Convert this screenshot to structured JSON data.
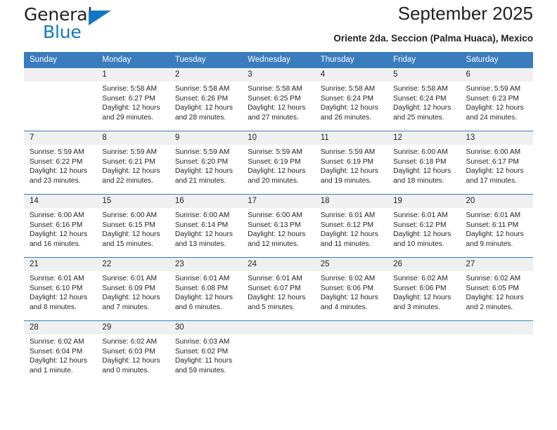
{
  "brand": {
    "name_part1": "General",
    "name_part2": "Blue",
    "accent_color": "#1277c4"
  },
  "header": {
    "title": "September 2025",
    "subtitle": "Oriente 2da. Seccion (Palma Huaca), Mexico",
    "header_bg_color": "#3a7cbe",
    "daynum_bg_color": "#f0f0f0"
  },
  "weekdays": [
    "Sunday",
    "Monday",
    "Tuesday",
    "Wednesday",
    "Thursday",
    "Friday",
    "Saturday"
  ],
  "weeks": [
    [
      {
        "day": "",
        "sunrise": "",
        "sunset": "",
        "daylight1": "",
        "daylight2": ""
      },
      {
        "day": "1",
        "sunrise": "Sunrise: 5:58 AM",
        "sunset": "Sunset: 6:27 PM",
        "daylight1": "Daylight: 12 hours",
        "daylight2": "and 29 minutes."
      },
      {
        "day": "2",
        "sunrise": "Sunrise: 5:58 AM",
        "sunset": "Sunset: 6:26 PM",
        "daylight1": "Daylight: 12 hours",
        "daylight2": "and 28 minutes."
      },
      {
        "day": "3",
        "sunrise": "Sunrise: 5:58 AM",
        "sunset": "Sunset: 6:25 PM",
        "daylight1": "Daylight: 12 hours",
        "daylight2": "and 27 minutes."
      },
      {
        "day": "4",
        "sunrise": "Sunrise: 5:58 AM",
        "sunset": "Sunset: 6:24 PM",
        "daylight1": "Daylight: 12 hours",
        "daylight2": "and 26 minutes."
      },
      {
        "day": "5",
        "sunrise": "Sunrise: 5:58 AM",
        "sunset": "Sunset: 6:24 PM",
        "daylight1": "Daylight: 12 hours",
        "daylight2": "and 25 minutes."
      },
      {
        "day": "6",
        "sunrise": "Sunrise: 5:59 AM",
        "sunset": "Sunset: 6:23 PM",
        "daylight1": "Daylight: 12 hours",
        "daylight2": "and 24 minutes."
      }
    ],
    [
      {
        "day": "7",
        "sunrise": "Sunrise: 5:59 AM",
        "sunset": "Sunset: 6:22 PM",
        "daylight1": "Daylight: 12 hours",
        "daylight2": "and 23 minutes."
      },
      {
        "day": "8",
        "sunrise": "Sunrise: 5:59 AM",
        "sunset": "Sunset: 6:21 PM",
        "daylight1": "Daylight: 12 hours",
        "daylight2": "and 22 minutes."
      },
      {
        "day": "9",
        "sunrise": "Sunrise: 5:59 AM",
        "sunset": "Sunset: 6:20 PM",
        "daylight1": "Daylight: 12 hours",
        "daylight2": "and 21 minutes."
      },
      {
        "day": "10",
        "sunrise": "Sunrise: 5:59 AM",
        "sunset": "Sunset: 6:19 PM",
        "daylight1": "Daylight: 12 hours",
        "daylight2": "and 20 minutes."
      },
      {
        "day": "11",
        "sunrise": "Sunrise: 5:59 AM",
        "sunset": "Sunset: 6:19 PM",
        "daylight1": "Daylight: 12 hours",
        "daylight2": "and 19 minutes."
      },
      {
        "day": "12",
        "sunrise": "Sunrise: 6:00 AM",
        "sunset": "Sunset: 6:18 PM",
        "daylight1": "Daylight: 12 hours",
        "daylight2": "and 18 minutes."
      },
      {
        "day": "13",
        "sunrise": "Sunrise: 6:00 AM",
        "sunset": "Sunset: 6:17 PM",
        "daylight1": "Daylight: 12 hours",
        "daylight2": "and 17 minutes."
      }
    ],
    [
      {
        "day": "14",
        "sunrise": "Sunrise: 6:00 AM",
        "sunset": "Sunset: 6:16 PM",
        "daylight1": "Daylight: 12 hours",
        "daylight2": "and 16 minutes."
      },
      {
        "day": "15",
        "sunrise": "Sunrise: 6:00 AM",
        "sunset": "Sunset: 6:15 PM",
        "daylight1": "Daylight: 12 hours",
        "daylight2": "and 15 minutes."
      },
      {
        "day": "16",
        "sunrise": "Sunrise: 6:00 AM",
        "sunset": "Sunset: 6:14 PM",
        "daylight1": "Daylight: 12 hours",
        "daylight2": "and 13 minutes."
      },
      {
        "day": "17",
        "sunrise": "Sunrise: 6:00 AM",
        "sunset": "Sunset: 6:13 PM",
        "daylight1": "Daylight: 12 hours",
        "daylight2": "and 12 minutes."
      },
      {
        "day": "18",
        "sunrise": "Sunrise: 6:01 AM",
        "sunset": "Sunset: 6:12 PM",
        "daylight1": "Daylight: 12 hours",
        "daylight2": "and 11 minutes."
      },
      {
        "day": "19",
        "sunrise": "Sunrise: 6:01 AM",
        "sunset": "Sunset: 6:12 PM",
        "daylight1": "Daylight: 12 hours",
        "daylight2": "and 10 minutes."
      },
      {
        "day": "20",
        "sunrise": "Sunrise: 6:01 AM",
        "sunset": "Sunset: 6:11 PM",
        "daylight1": "Daylight: 12 hours",
        "daylight2": "and 9 minutes."
      }
    ],
    [
      {
        "day": "21",
        "sunrise": "Sunrise: 6:01 AM",
        "sunset": "Sunset: 6:10 PM",
        "daylight1": "Daylight: 12 hours",
        "daylight2": "and 8 minutes."
      },
      {
        "day": "22",
        "sunrise": "Sunrise: 6:01 AM",
        "sunset": "Sunset: 6:09 PM",
        "daylight1": "Daylight: 12 hours",
        "daylight2": "and 7 minutes."
      },
      {
        "day": "23",
        "sunrise": "Sunrise: 6:01 AM",
        "sunset": "Sunset: 6:08 PM",
        "daylight1": "Daylight: 12 hours",
        "daylight2": "and 6 minutes."
      },
      {
        "day": "24",
        "sunrise": "Sunrise: 6:01 AM",
        "sunset": "Sunset: 6:07 PM",
        "daylight1": "Daylight: 12 hours",
        "daylight2": "and 5 minutes."
      },
      {
        "day": "25",
        "sunrise": "Sunrise: 6:02 AM",
        "sunset": "Sunset: 6:06 PM",
        "daylight1": "Daylight: 12 hours",
        "daylight2": "and 4 minutes."
      },
      {
        "day": "26",
        "sunrise": "Sunrise: 6:02 AM",
        "sunset": "Sunset: 6:06 PM",
        "daylight1": "Daylight: 12 hours",
        "daylight2": "and 3 minutes."
      },
      {
        "day": "27",
        "sunrise": "Sunrise: 6:02 AM",
        "sunset": "Sunset: 6:05 PM",
        "daylight1": "Daylight: 12 hours",
        "daylight2": "and 2 minutes."
      }
    ],
    [
      {
        "day": "28",
        "sunrise": "Sunrise: 6:02 AM",
        "sunset": "Sunset: 6:04 PM",
        "daylight1": "Daylight: 12 hours",
        "daylight2": "and 1 minute."
      },
      {
        "day": "29",
        "sunrise": "Sunrise: 6:02 AM",
        "sunset": "Sunset: 6:03 PM",
        "daylight1": "Daylight: 12 hours",
        "daylight2": "and 0 minutes."
      },
      {
        "day": "30",
        "sunrise": "Sunrise: 6:03 AM",
        "sunset": "Sunset: 6:02 PM",
        "daylight1": "Daylight: 11 hours",
        "daylight2": "and 59 minutes."
      },
      {
        "day": "",
        "sunrise": "",
        "sunset": "",
        "daylight1": "",
        "daylight2": ""
      },
      {
        "day": "",
        "sunrise": "",
        "sunset": "",
        "daylight1": "",
        "daylight2": ""
      },
      {
        "day": "",
        "sunrise": "",
        "sunset": "",
        "daylight1": "",
        "daylight2": ""
      },
      {
        "day": "",
        "sunrise": "",
        "sunset": "",
        "daylight1": "",
        "daylight2": ""
      }
    ]
  ]
}
